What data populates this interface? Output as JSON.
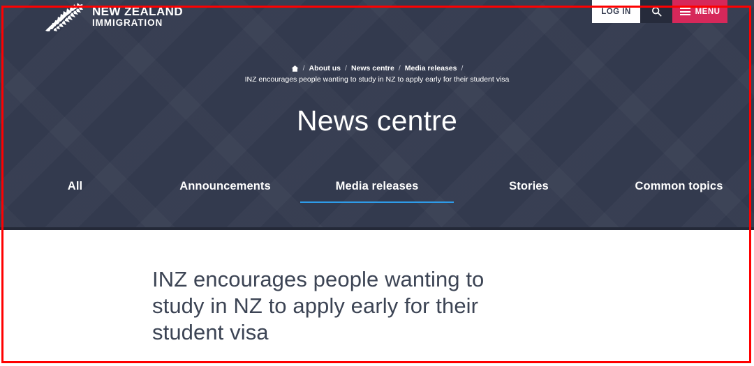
{
  "brand": {
    "logo_icon": "silver-fern-icon",
    "line1": "NEW ZEALAND",
    "line2": "IMMIGRATION"
  },
  "utility_nav": {
    "login_label": "LOG IN",
    "search_icon": "search-icon",
    "menu_label": "MENU",
    "menu_icon": "hamburger-icon",
    "menu_color": "#d6285a"
  },
  "breadcrumb": {
    "home_icon": "home-icon",
    "separator": "/",
    "items": [
      {
        "label": "About us"
      },
      {
        "label": "News centre"
      },
      {
        "label": "Media releases"
      }
    ],
    "current": "INZ encourages people wanting to study in NZ to apply early for their student visa"
  },
  "hero": {
    "title": "News centre",
    "background_color": "#333a4e"
  },
  "tabs": {
    "active_index": 2,
    "active_underline_color": "#2e9be8",
    "items": [
      {
        "label": "All"
      },
      {
        "label": "Announcements"
      },
      {
        "label": "Media releases"
      },
      {
        "label": "Stories"
      },
      {
        "label": "Common topics"
      }
    ]
  },
  "main": {
    "article_headline": "INZ encourages people wanting to study in NZ to apply early for their student visa"
  },
  "annotation": {
    "border_color": "#ff0000"
  }
}
